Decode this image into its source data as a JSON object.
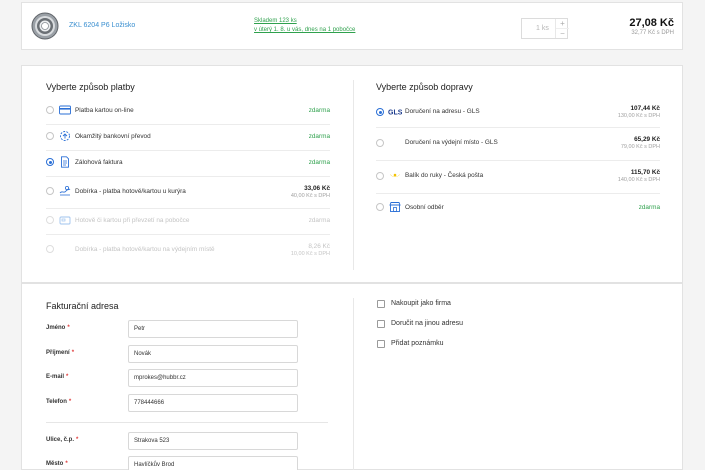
{
  "product": {
    "name": "ZKL 6204 P6 Ložisko",
    "stock_line1": "Skladem 123 ks",
    "stock_line2": "v úterý 1. 8. u vás, dnes na 1 pobočce",
    "quantity": "1",
    "quantity_unit": "ks",
    "plus": "+",
    "minus": "−",
    "price": "27,08 Kč",
    "price_excl_vat": "32,77 Kč s DPH"
  },
  "payment": {
    "title": "Vyberte způsob platby",
    "options": [
      {
        "label": "Platba kartou on-line",
        "price": "zdarma"
      },
      {
        "label": "Okamžitý bankovní převod",
        "price": "zdarma"
      },
      {
        "label": "Zálohová faktura",
        "price": "zdarma",
        "selected": true
      },
      {
        "label": "Dobírka - platba hotově/kartou u kurýra",
        "price": "33,06 Kč",
        "price_sub": "40,00 Kč s DPH"
      },
      {
        "label": "Hotově či kartou při převzetí na pobočce",
        "price": "zdarma",
        "disabled": true
      },
      {
        "label": "Dobírka - platba hotově/kartou na výdejním místě",
        "price": "8,26 Kč",
        "price_sub": "10,00 Kč s DPH",
        "disabled": true
      }
    ]
  },
  "shipping": {
    "title": "Vyberte způsob dopravy",
    "options": [
      {
        "label": "Doručení na adresu - GLS",
        "price": "107,44 Kč",
        "price_sub": "130,00 Kč s DPH",
        "selected": true
      },
      {
        "label": "Doručení na výdejní místo - GLS",
        "price": "65,29 Kč",
        "price_sub": "79,00 Kč s DPH"
      },
      {
        "label": "Balík do ruky - Česká pošta",
        "price": "115,70 Kč",
        "price_sub": "140,00 Kč s DPH"
      },
      {
        "label": "Osobní odběr",
        "price": "zdarma"
      }
    ]
  },
  "billing": {
    "title": "Fakturační adresa",
    "fields": [
      {
        "label": "Jméno",
        "value": "Petr"
      },
      {
        "label": "Příjmení",
        "value": "Novák"
      },
      {
        "label": "E-mail",
        "value": "mprokes@hubbr.cz"
      },
      {
        "label": "Telefon",
        "value": "778444666"
      },
      {
        "label": "Ulice, č.p.",
        "value": "Strakova 523"
      },
      {
        "label": "Město",
        "value": "Havlíčkův Brod"
      }
    ],
    "required_mark": "*"
  },
  "options": {
    "company": "Nakoupit jako firma",
    "other_address": "Doručit na jinou adresu",
    "note": "Přidat poznámku"
  },
  "colors": {
    "green": "#2fa14d",
    "blue": "#2a6fd6",
    "link": "#3a8fd0"
  }
}
